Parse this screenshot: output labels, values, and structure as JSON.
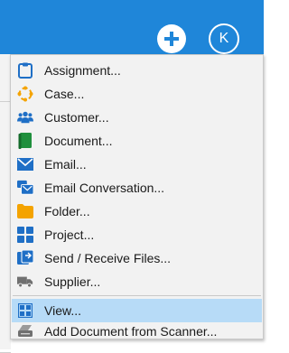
{
  "header": {
    "add_label": "+",
    "avatar_initial": "K"
  },
  "menu": {
    "items": [
      {
        "label": "Assignment...",
        "icon": "clipboard-icon"
      },
      {
        "label": "Case...",
        "icon": "case-cycle-icon"
      },
      {
        "label": "Customer...",
        "icon": "customers-icon"
      },
      {
        "label": "Document...",
        "icon": "document-icon"
      },
      {
        "label": "Email...",
        "icon": "email-icon"
      },
      {
        "label": "Email Conversation...",
        "icon": "email-conversation-icon"
      },
      {
        "label": "Folder...",
        "icon": "folder-icon"
      },
      {
        "label": "Project...",
        "icon": "project-icon"
      },
      {
        "label": "Send / Receive Files...",
        "icon": "send-receive-icon"
      },
      {
        "label": "Supplier...",
        "icon": "truck-icon"
      },
      {
        "label": "View...",
        "icon": "view-grid-icon",
        "highlighted": true
      },
      {
        "label": "Add Document from Scanner...",
        "icon": "scanner-icon"
      }
    ]
  },
  "colors": {
    "header": "#1f86d9",
    "highlight": "#b7dbf7",
    "menu_bg": "#f2f2f2"
  }
}
